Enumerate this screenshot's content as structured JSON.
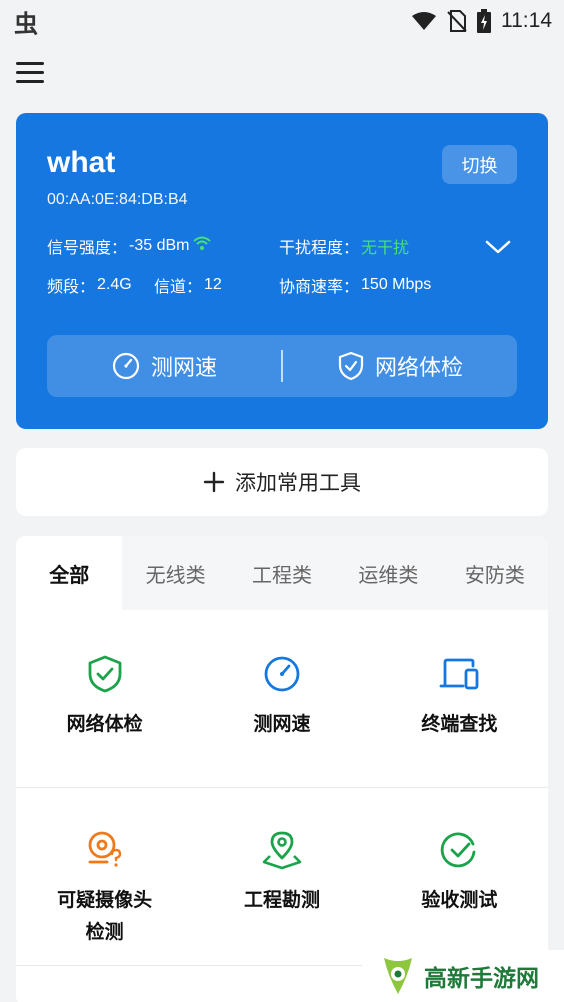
{
  "status_bar": {
    "app_glyph": "虫",
    "time": "11:14",
    "icons": [
      "wifi-icon",
      "no-sim-icon",
      "battery-charging-icon"
    ]
  },
  "wifi": {
    "ssid": "what",
    "mac": "00:AA:0E:84:DB:B4",
    "switch_label": "切换",
    "signal_label": "信号强度：",
    "signal_value": "-35 dBm",
    "interference_label": "干扰程度：",
    "interference_value": "无干扰",
    "band_label": "频段：",
    "band_value": "2.4G",
    "channel_label": "信道：",
    "channel_value": "12",
    "rate_label": "协商速率：",
    "rate_value": "150 Mbps",
    "speed_test_label": "测网速",
    "checkup_label": "网络体检"
  },
  "add_tools_label": "添加常用工具",
  "tabs": [
    "全部",
    "无线类",
    "工程类",
    "运维类",
    "安防类"
  ],
  "tools": [
    {
      "label": "网络体检",
      "icon": "shield-check-icon",
      "color": "#1aa34a"
    },
    {
      "label": "测网速",
      "icon": "speedometer-icon",
      "color": "#1677e0"
    },
    {
      "label": "终端查找",
      "icon": "devices-icon",
      "color": "#1677e0"
    },
    {
      "label": "可疑摄像头\n检测",
      "icon": "camera-search-icon",
      "color": "#f07a1a"
    },
    {
      "label": "工程勘测",
      "icon": "map-pin-icon",
      "color": "#1aa34a"
    },
    {
      "label": "验收测试",
      "icon": "check-circle-icon",
      "color": "#1aa34a"
    }
  ],
  "watermark": "高新手游网",
  "colors": {
    "accent_blue": "#1677e0",
    "green": "#1aa34a",
    "orange": "#f07a1a",
    "light_green_text": "#45e07a"
  }
}
